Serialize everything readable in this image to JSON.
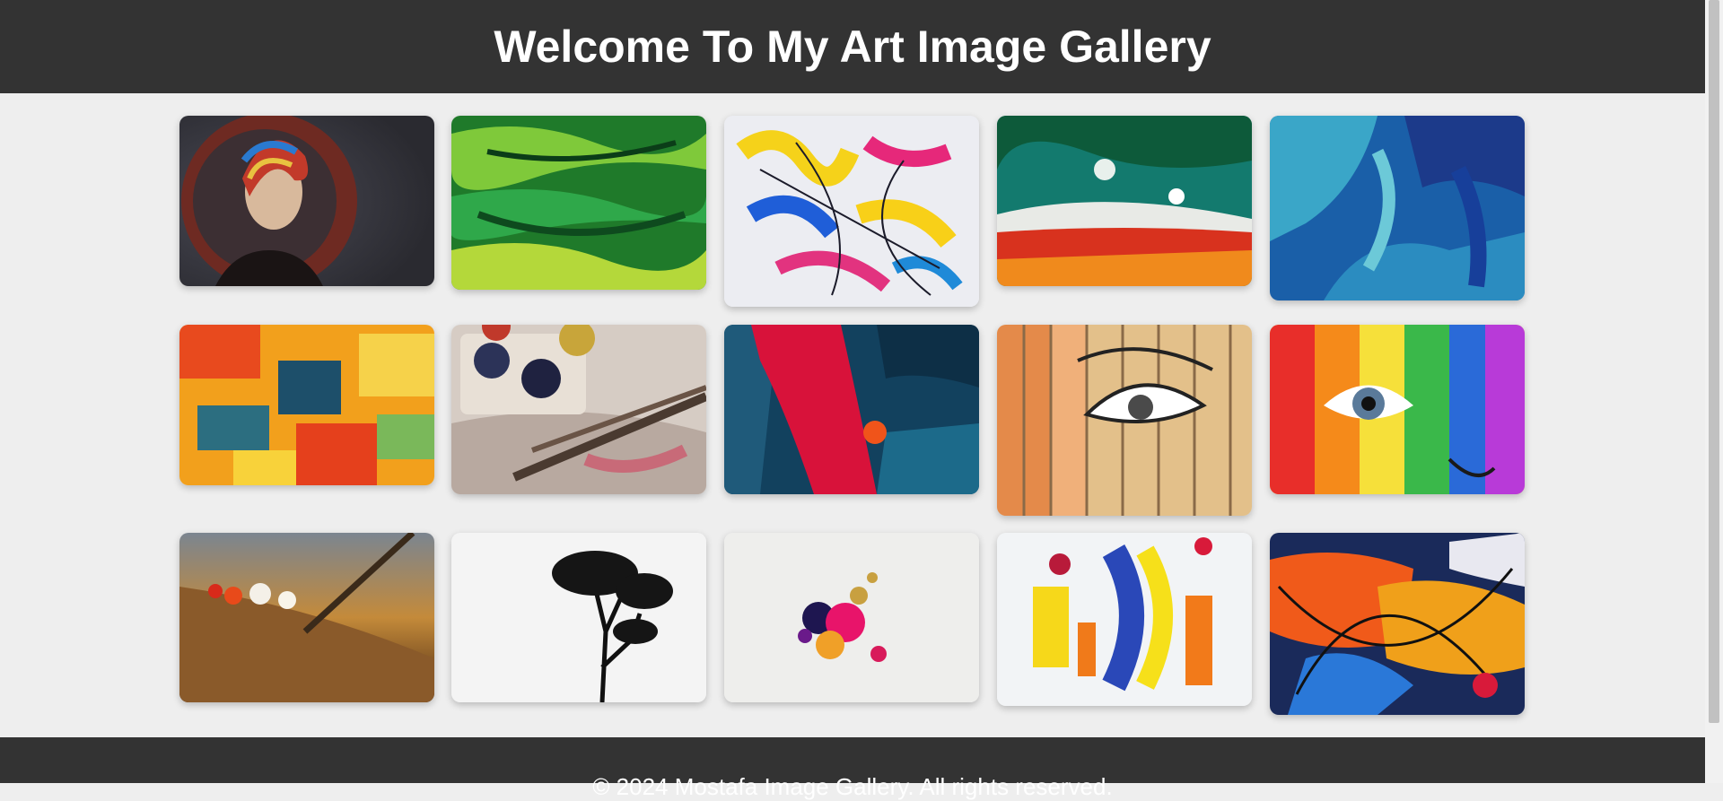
{
  "header": {
    "title": "Welcome To My Art Image Gallery"
  },
  "gallery": {
    "images": [
      {
        "subject": "woman-portrait-headscarf"
      },
      {
        "subject": "green-abstract-paint"
      },
      {
        "subject": "colorful-brush-strokes"
      },
      {
        "subject": "teal-red-abstract"
      },
      {
        "subject": "blue-texture-paint"
      },
      {
        "subject": "orange-patchwork-abstract"
      },
      {
        "subject": "paint-palette-brushes"
      },
      {
        "subject": "red-dark-blue-abstract"
      },
      {
        "subject": "eye-mural-wood-fence"
      },
      {
        "subject": "rainbow-face-paint"
      },
      {
        "subject": "brush-on-palette"
      },
      {
        "subject": "tree-silhouette"
      },
      {
        "subject": "paint-splash"
      },
      {
        "subject": "yellow-blue-strokes"
      },
      {
        "subject": "pollock-style-abstract"
      }
    ]
  },
  "footer": {
    "text": "© 2024 Mostafa Image Gallery. All rights reserved."
  },
  "colors": {
    "header_bg": "#333333",
    "page_bg": "#eeeeee",
    "text": "#ffffff"
  }
}
